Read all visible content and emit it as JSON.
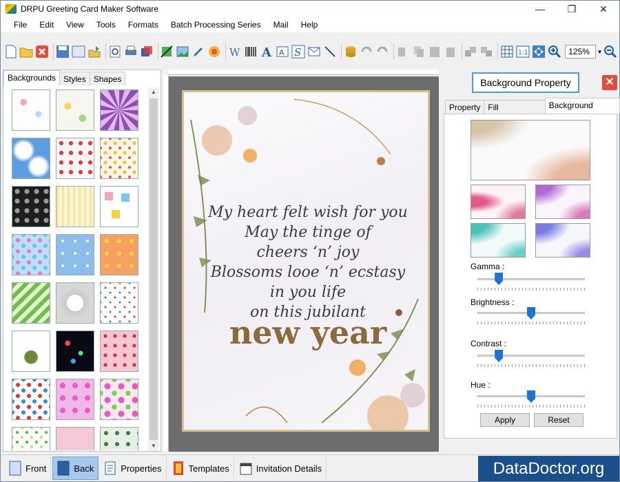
{
  "window": {
    "title": "DRPU Greeting Card Maker Software",
    "minimize": "—",
    "maximize": "❐",
    "close": "✕"
  },
  "menu": [
    "File",
    "Edit",
    "View",
    "Tools",
    "Formats",
    "Batch Processing Series",
    "Mail",
    "Help"
  ],
  "toolbar": {
    "zoom_value": "125%"
  },
  "left_panel": {
    "tabs": [
      "Backgrounds",
      "Styles",
      "Shapes"
    ],
    "active_tab": "Backgrounds"
  },
  "card": {
    "lines": [
      "My heart felt wish for you",
      "May the tinge of",
      "cheers ‘n’ joy",
      "Blossoms looe ‘n’ ecstasy",
      "in you life",
      "on this jubilant"
    ],
    "highlight": "new year"
  },
  "right_panel": {
    "title": "Background Property",
    "tabs": [
      "Property",
      "Fill Background",
      "Background Effects"
    ],
    "active_tab": "Background Effects",
    "sliders": [
      {
        "label": "Gamma :",
        "value": 0.2
      },
      {
        "label": "Brightness :",
        "value": 0.5
      },
      {
        "label": "Contrast :",
        "value": 0.2
      },
      {
        "label": "Hue :",
        "value": 0.5
      }
    ],
    "apply_label": "Apply",
    "reset_label": "Reset"
  },
  "bottom_bar": {
    "front": "Front",
    "back": "Back",
    "properties": "Properties",
    "templates": "Templates",
    "invitation": "Invitation Details",
    "brand": "DataDoctor.org"
  },
  "colors": {
    "accent": "#1f73d1",
    "close_red": "#e34b3c",
    "card_border": "#d9bf8c",
    "highlight_text": "#8b6a3c",
    "brand_bg": "#1a4f8c"
  }
}
